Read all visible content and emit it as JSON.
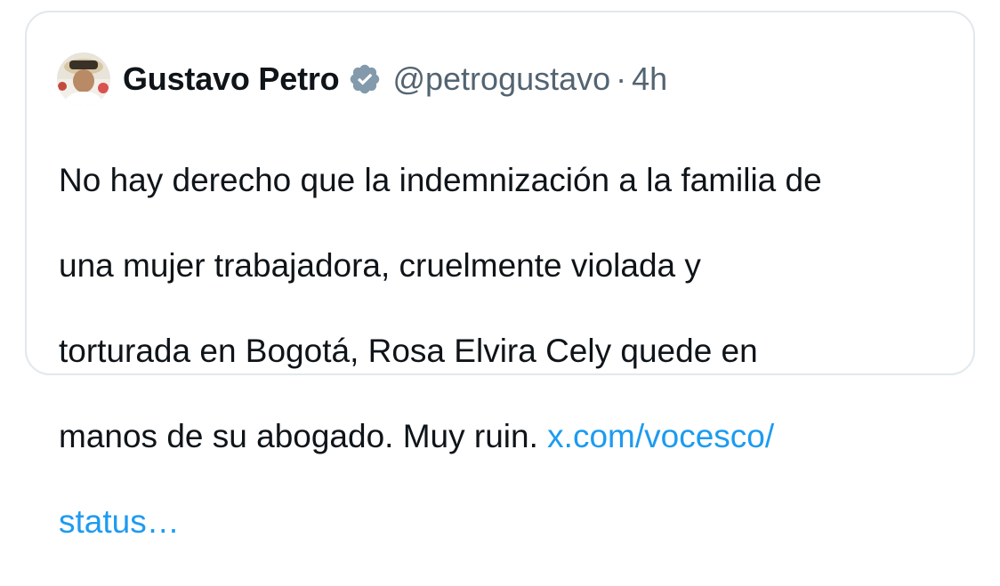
{
  "tweet": {
    "author_name": "Gustavo Petro",
    "handle": "@petrogustavo",
    "separator": "·",
    "time": "4h",
    "lines": [
      "No hay derecho que la indemnización a la familia de",
      "una mujer trabajadora,  cruelmente violada y",
      "torturada en Bogotá, Rosa Elvira Cely quede en",
      "manos de su abogado. Muy ruin. "
    ],
    "link_part1": "x.com/vocesco/",
    "link_part2": "status…"
  },
  "icons": {
    "verified": "verified-badge-icon",
    "avatar": "profile-photo"
  },
  "colors": {
    "link": "#1d9bf0",
    "secondary_text": "#536471",
    "primary_text": "#0f1419",
    "verified_badge": "#829aab",
    "border": "#e1e8ed"
  }
}
